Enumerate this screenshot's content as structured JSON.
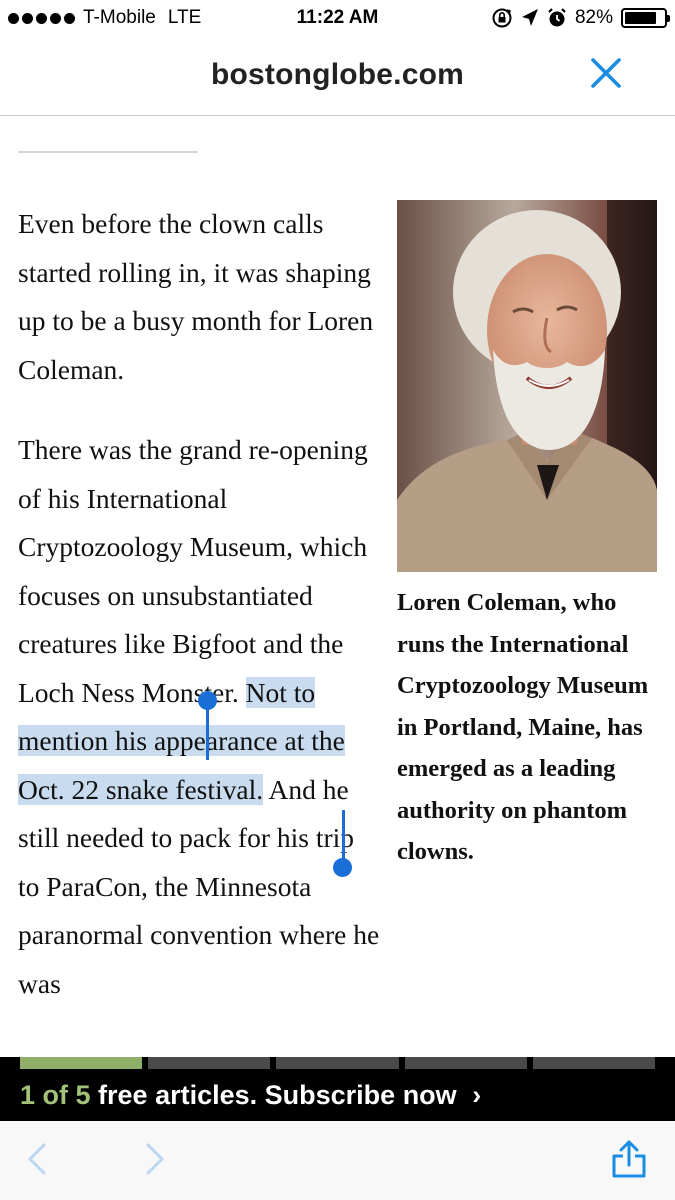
{
  "status_bar": {
    "carrier": "T-Mobile",
    "network": "LTE",
    "time": "11:22 AM",
    "battery": "82%",
    "battery_level": 0.82,
    "icons": [
      "signal-dots",
      "orientation-lock-icon",
      "location-arrow-icon",
      "alarm-icon",
      "battery-icon"
    ]
  },
  "nav": {
    "title": "bostonglobe.com",
    "close_icon": "close-icon",
    "accent": "#1a8de0"
  },
  "article": {
    "p1": "Even before the clown calls started rolling in, it was shaping up to be a busy month for Loren Coleman.",
    "p2_before": "There was the grand re-opening of his International Cryptozoology Museum, which focuses on unsubstantiated creatures like Bigfoot and the Loch Ness Monster. ",
    "p2_selected": "Not to mention his appearance at the Oct. 22 snake festival.",
    "p2_after": " And he still needed to pack for his trip to ParaCon, the Minnesota paranormal convention where he was",
    "selection_color": "#c9dbee"
  },
  "photo": {
    "caption": "Loren Coleman, who runs the International Cryptozoology Museum in Portland, Maine, has emerged as a leading authority on phantom clowns."
  },
  "paywall": {
    "count": "1 of 5",
    "text": "free articles. Subscribe now",
    "chevron": "›",
    "segments_total": 5,
    "segments_used": 1,
    "accent": "#8fae6a"
  },
  "toolbar": {
    "back_icon": "chevron-left-icon",
    "forward_icon": "chevron-right-icon",
    "share_icon": "share-icon"
  }
}
